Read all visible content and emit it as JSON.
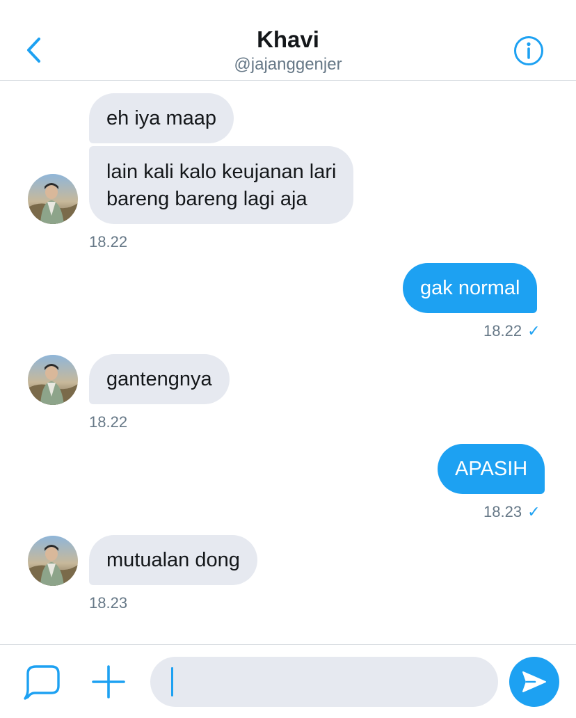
{
  "header": {
    "name": "Khavi",
    "handle": "@jajanggenjer",
    "back_icon": "chevron-left-icon",
    "info_icon": "info-icon"
  },
  "messages": [
    {
      "direction": "received",
      "text": "eh iya maap"
    },
    {
      "direction": "received",
      "line1": "lain kali kalo keujanan lari",
      "line2": "bareng bareng lagi aja",
      "time": "18.22"
    },
    {
      "direction": "sent",
      "text": "gak normal",
      "time": "18.22",
      "status": "✓"
    },
    {
      "direction": "received",
      "text": "gantengnya",
      "time": "18.22"
    },
    {
      "direction": "sent",
      "text": "APASIH",
      "time": "18.23",
      "status": "✓"
    },
    {
      "direction": "received",
      "text": "mutualan dong",
      "time": "18.23"
    }
  ],
  "composer": {
    "input_value": "",
    "gif_icon": "chat-bubble-icon",
    "add_icon": "plus-icon",
    "send_icon": "send-icon"
  },
  "colors": {
    "accent": "#1da1f2",
    "received_bubble": "#e6e9f0",
    "secondary_text": "#657786",
    "divider": "#d6dbe0"
  }
}
